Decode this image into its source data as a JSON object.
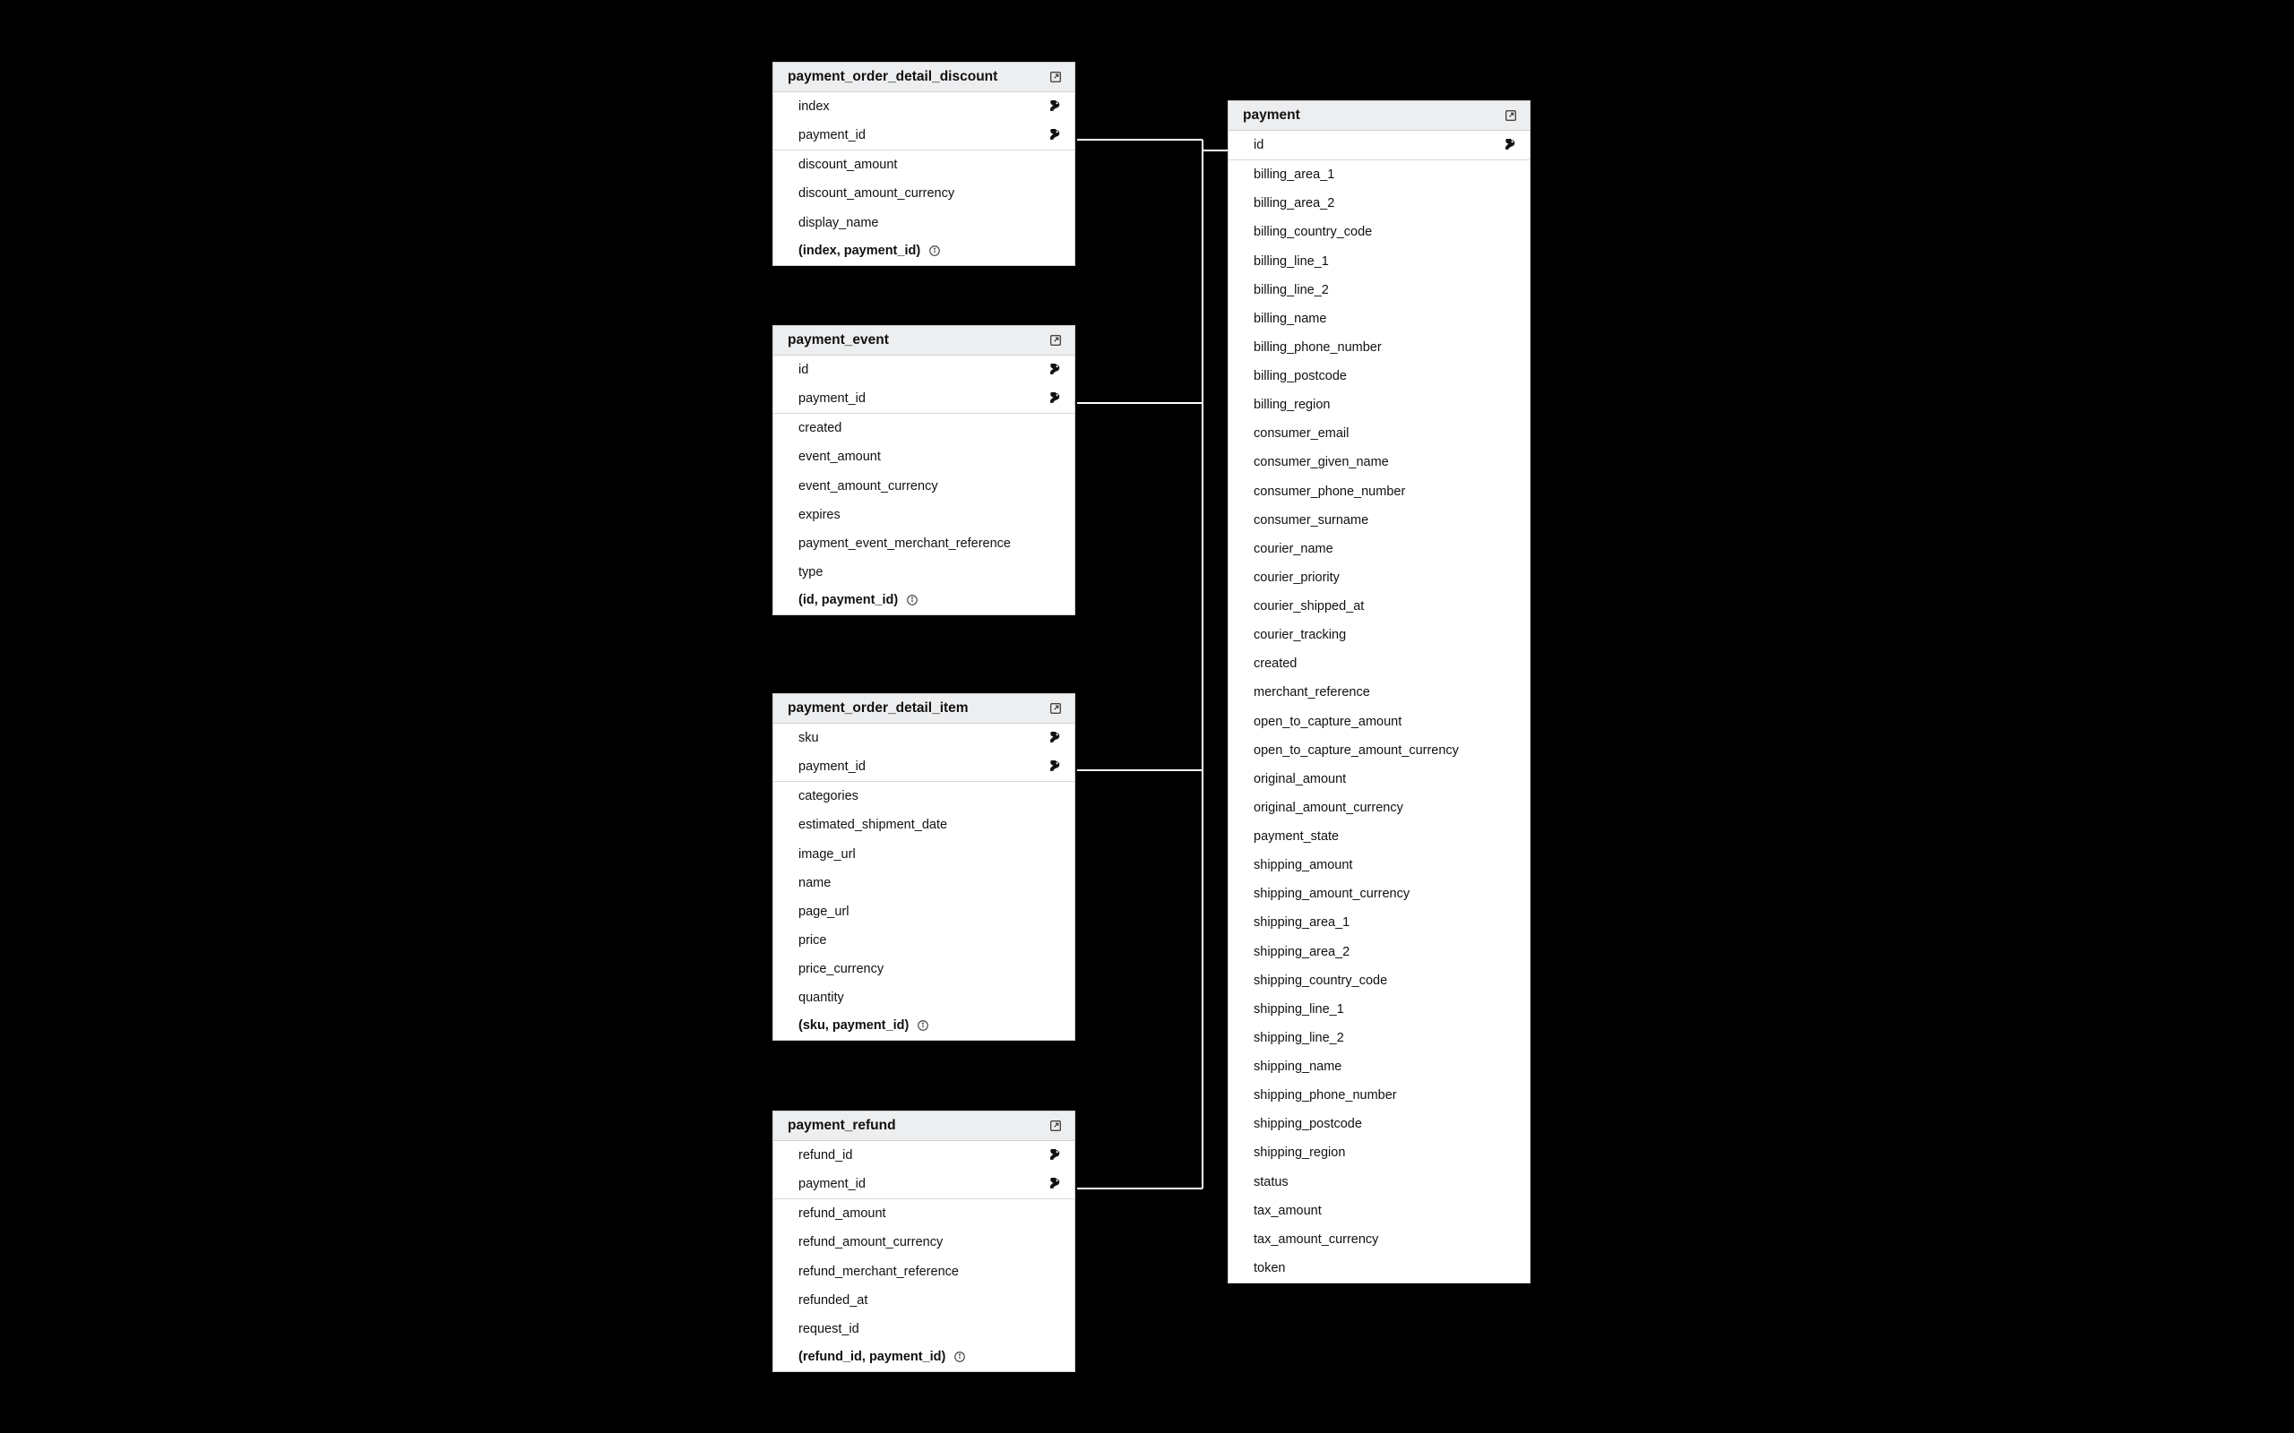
{
  "tables": {
    "payment_order_detail_discount": {
      "title": "payment_order_detail_discount",
      "keys": [
        {
          "name": "index"
        },
        {
          "name": "payment_id"
        }
      ],
      "cols": [
        "discount_amount",
        "discount_amount_currency",
        "display_name"
      ],
      "footer": "(index, payment_id)"
    },
    "payment_event": {
      "title": "payment_event",
      "keys": [
        {
          "name": "id"
        },
        {
          "name": "payment_id"
        }
      ],
      "cols": [
        "created",
        "event_amount",
        "event_amount_currency",
        "expires",
        "payment_event_merchant_reference",
        "type"
      ],
      "footer": "(id, payment_id)"
    },
    "payment_order_detail_item": {
      "title": "payment_order_detail_item",
      "keys": [
        {
          "name": "sku"
        },
        {
          "name": "payment_id"
        }
      ],
      "cols": [
        "categories",
        "estimated_shipment_date",
        "image_url",
        "name",
        "page_url",
        "price",
        "price_currency",
        "quantity"
      ],
      "footer": "(sku, payment_id)"
    },
    "payment_refund": {
      "title": "payment_refund",
      "keys": [
        {
          "name": "refund_id"
        },
        {
          "name": "payment_id"
        }
      ],
      "cols": [
        "refund_amount",
        "refund_amount_currency",
        "refund_merchant_reference",
        "refunded_at",
        "request_id"
      ],
      "footer": "(refund_id, payment_id)"
    },
    "payment": {
      "title": "payment",
      "keys": [
        {
          "name": "id"
        }
      ],
      "cols": [
        "billing_area_1",
        "billing_area_2",
        "billing_country_code",
        "billing_line_1",
        "billing_line_2",
        "billing_name",
        "billing_phone_number",
        "billing_postcode",
        "billing_region",
        "consumer_email",
        "consumer_given_name",
        "consumer_phone_number",
        "consumer_surname",
        "courier_name",
        "courier_priority",
        "courier_shipped_at",
        "courier_tracking",
        "created",
        "merchant_reference",
        "open_to_capture_amount",
        "open_to_capture_amount_currency",
        "original_amount",
        "original_amount_currency",
        "payment_state",
        "shipping_amount",
        "shipping_amount_currency",
        "shipping_area_1",
        "shipping_area_2",
        "shipping_country_code",
        "shipping_line_1",
        "shipping_line_2",
        "shipping_name",
        "shipping_phone_number",
        "shipping_postcode",
        "shipping_region",
        "status",
        "tax_amount",
        "tax_amount_currency",
        "token"
      ]
    }
  },
  "relationships": [
    {
      "from": "payment_order_detail_discount.payment_id",
      "to": "payment.id"
    },
    {
      "from": "payment_event.payment_id",
      "to": "payment.id"
    },
    {
      "from": "payment_order_detail_item.payment_id",
      "to": "payment.id"
    },
    {
      "from": "payment_refund.payment_id",
      "to": "payment.id"
    }
  ]
}
